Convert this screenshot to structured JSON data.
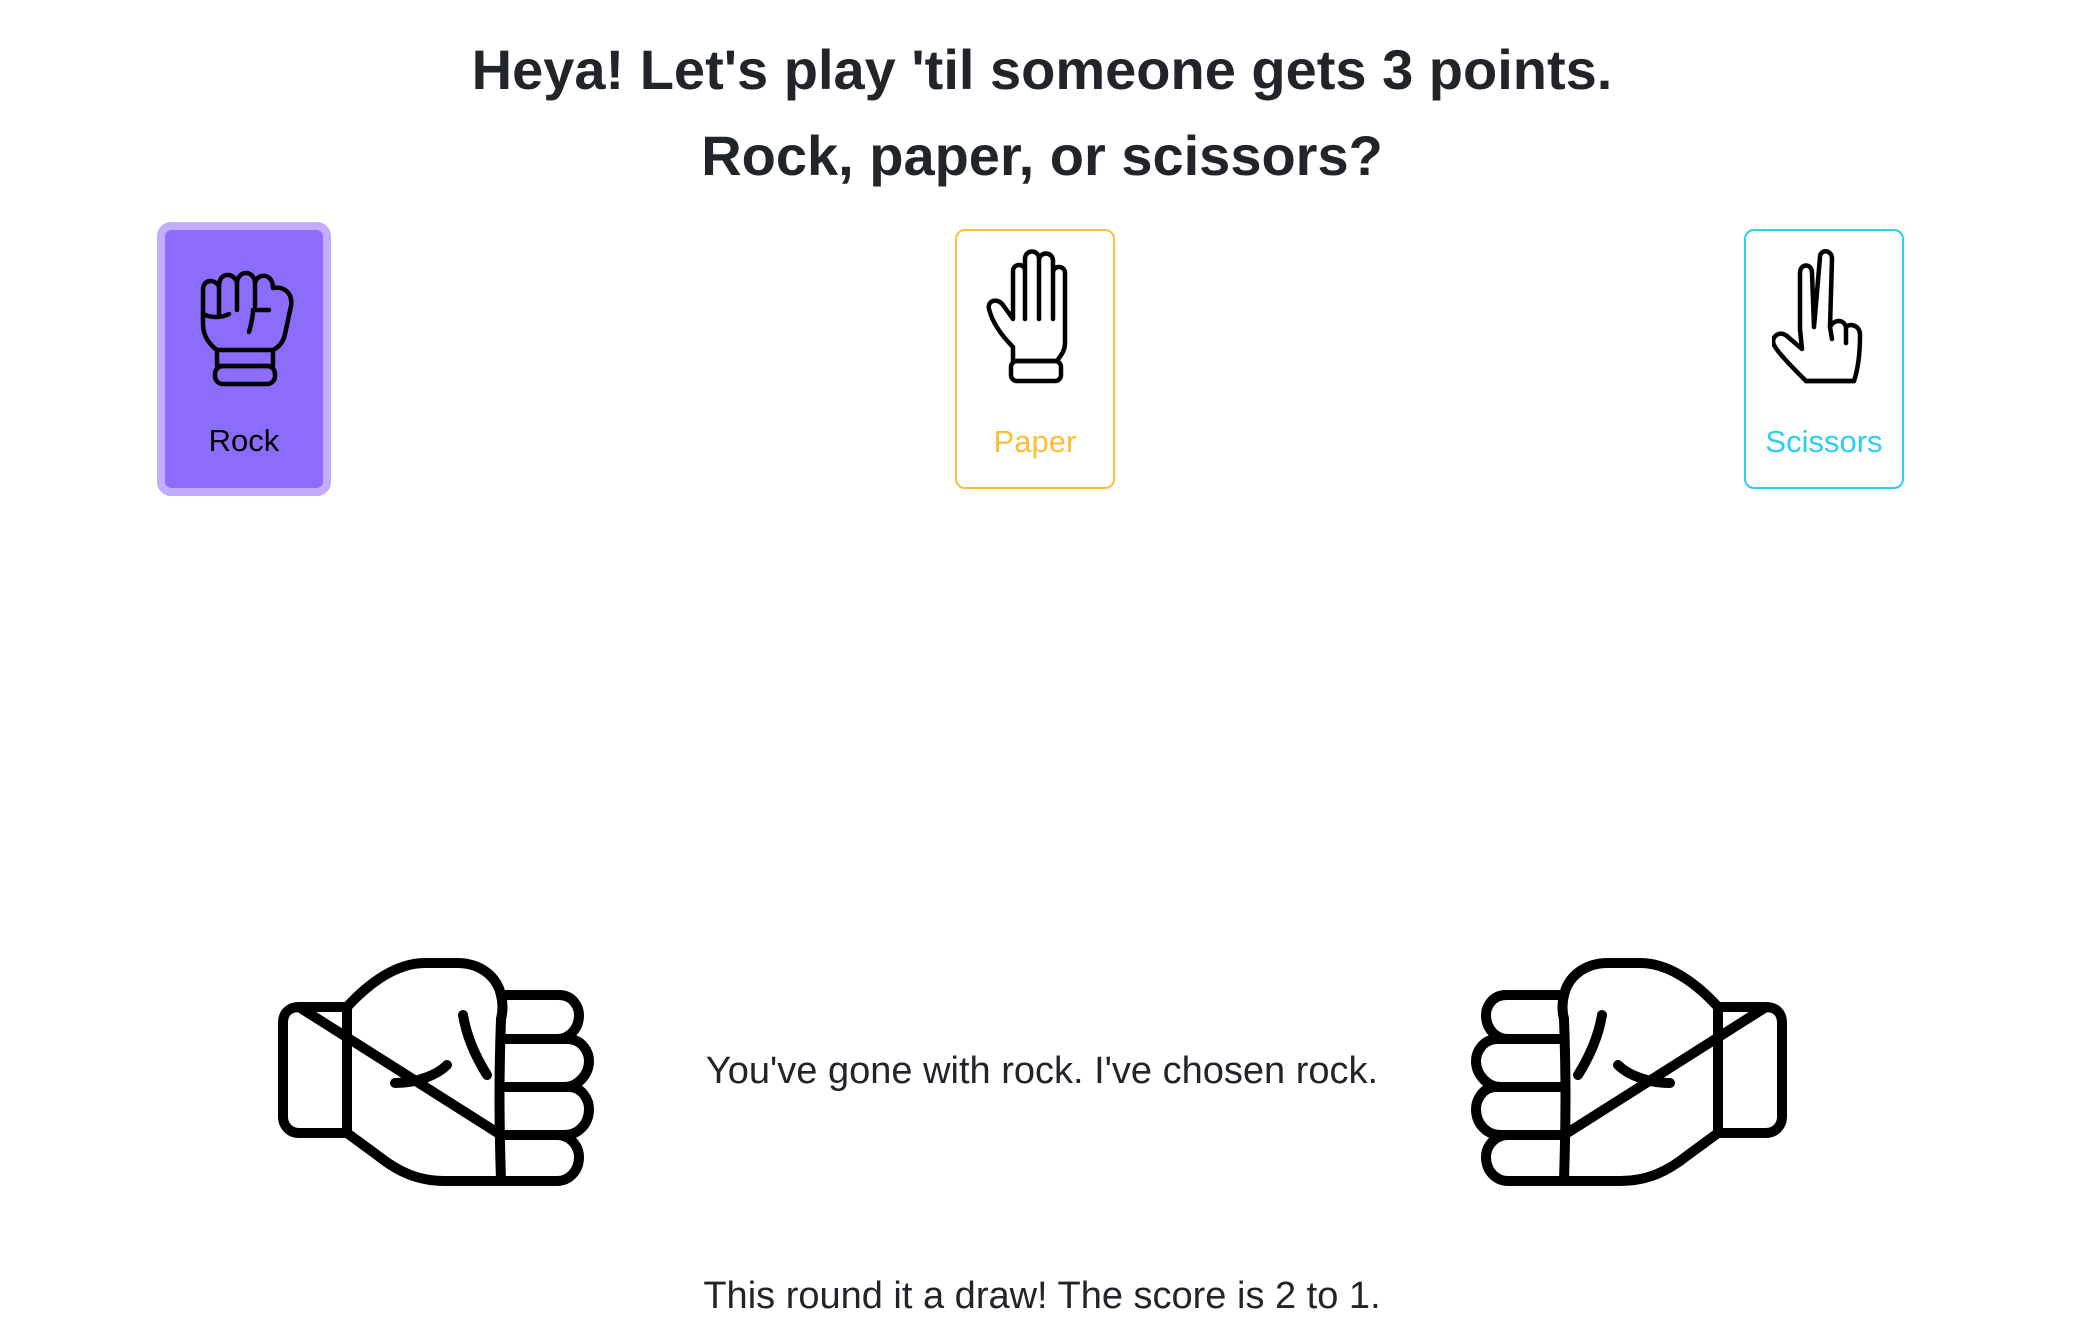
{
  "heading": {
    "line1": "Heya! Let's play 'til someone gets 3 points.",
    "line2": "Rock, paper, or scissors?"
  },
  "choices": [
    {
      "id": "rock",
      "label": "Rock",
      "icon": "fist-icon",
      "selected": true,
      "color": "#8c6cfb"
    },
    {
      "id": "paper",
      "label": "Paper",
      "icon": "open-hand-icon",
      "selected": false,
      "color": "#fdbd36"
    },
    {
      "id": "scissors",
      "label": "Scissors",
      "icon": "two-fingers-icon",
      "selected": false,
      "color": "#2bcdf1"
    }
  ],
  "round": {
    "player_hand": "fist-icon",
    "computer_hand": "fist-icon",
    "choice_message": "You've gone with rock. I've chosen rock.",
    "result_message": "This round it a draw! The score is 2 to 1."
  }
}
